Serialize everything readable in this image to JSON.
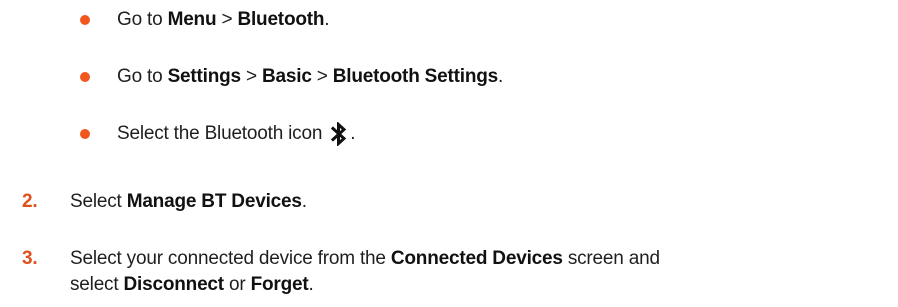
{
  "bullets": [
    {
      "parts": [
        "Go to ",
        "Menu",
        " > ",
        "Bluetooth",
        "."
      ]
    },
    {
      "parts": [
        "Go to ",
        "Settings",
        " > ",
        "Basic",
        " > ",
        "Bluetooth Settings",
        "."
      ]
    },
    {
      "parts": [
        "Select the Bluetooth icon",
        "."
      ],
      "icon": "bluetooth-icon"
    }
  ],
  "steps": [
    {
      "number": "2.",
      "parts": [
        "Select ",
        "Manage BT Devices",
        "."
      ]
    },
    {
      "number": "3.",
      "parts": [
        "Select your connected device from the ",
        "Connected Devices",
        " screen and"
      ],
      "continuation": [
        "select ",
        "Disconnect",
        " or ",
        "Forget",
        "."
      ]
    }
  ],
  "colors": {
    "accent": "#f0561e",
    "text": "#1f1f1f"
  }
}
